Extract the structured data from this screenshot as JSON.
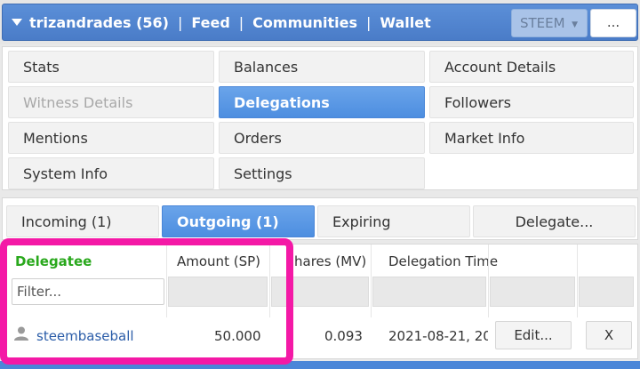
{
  "topbar": {
    "account": "trizandrades (56)",
    "links": [
      "Feed",
      "Communities",
      "Wallet"
    ],
    "separator": "|",
    "currency": "STEEM",
    "more_label": "..."
  },
  "menu": {
    "items": [
      {
        "label": "Stats",
        "state": "normal"
      },
      {
        "label": "Balances",
        "state": "normal"
      },
      {
        "label": "Account Details",
        "state": "normal"
      },
      {
        "label": "Witness Details",
        "state": "disabled"
      },
      {
        "label": "Delegations",
        "state": "active"
      },
      {
        "label": "Followers",
        "state": "normal"
      },
      {
        "label": "Mentions",
        "state": "normal"
      },
      {
        "label": "Orders",
        "state": "normal"
      },
      {
        "label": "Market Info",
        "state": "normal"
      },
      {
        "label": "System Info",
        "state": "normal"
      },
      {
        "label": "Settings",
        "state": "normal"
      }
    ]
  },
  "tabs": [
    {
      "label": "Incoming (1)",
      "active": false
    },
    {
      "label": "Outgoing (1)",
      "active": true
    },
    {
      "label": "Expiring",
      "active": false
    },
    {
      "label": "Delegate...",
      "active": false
    }
  ],
  "table": {
    "headers": [
      "Delegatee",
      "Amount (SP)",
      "hares (MV)",
      "Delegation Time"
    ],
    "filter_placeholder": "Filter...",
    "rows": [
      {
        "delegatee": "steembaseball",
        "amount": "50.000",
        "shares": "0.093",
        "time": "2021-08-21, 20",
        "edit_label": "Edit...",
        "remove_label": "X"
      }
    ]
  },
  "colors": {
    "accent": "#4d8ee0",
    "header_green": "#29a81c",
    "link": "#2a5ca8",
    "highlight": "#f419a6"
  },
  "icons": {
    "dropdown": "caret-down-icon",
    "user": "user-icon"
  }
}
